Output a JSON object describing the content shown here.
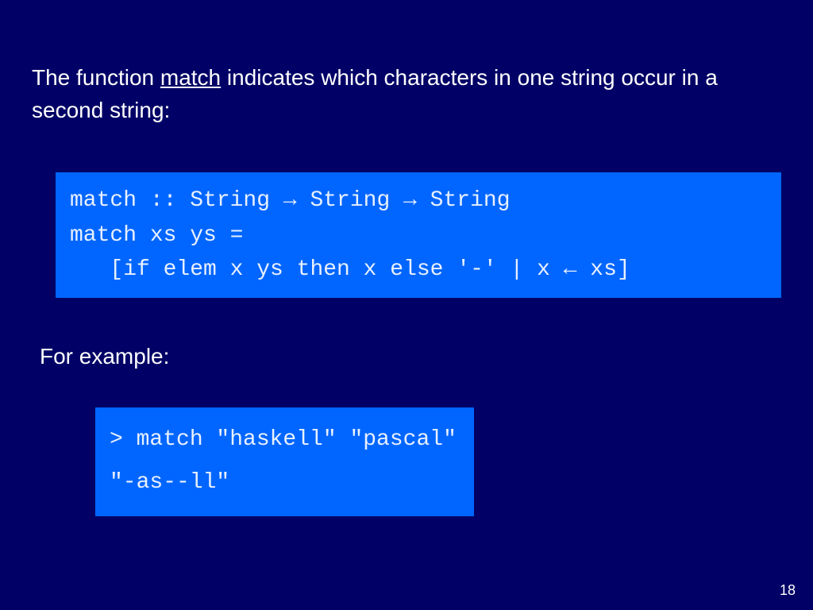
{
  "intro": {
    "pre": "The function ",
    "underlined": "match",
    "post": " indicates which characters in one string occur in a second string:"
  },
  "code1": {
    "line1": "match :: String → String → String",
    "line2": "match xs ys =",
    "line3": "   [if elem x ys then x else '-' | x ← xs]"
  },
  "for_example": "For example:",
  "code2": {
    "line1": "> match \"haskell\" \"pascal\"",
    "line2": "\"-as--ll\""
  },
  "page_number": "18"
}
